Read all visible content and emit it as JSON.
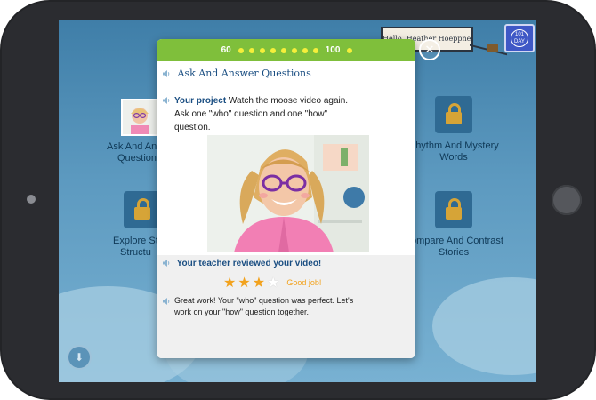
{
  "header": {
    "greeting": "Hello, Heather Hoeppner.",
    "badge_line1": "101",
    "badge_line2": "DAY"
  },
  "tiles": [
    {
      "label": "Ask And Answer Questions",
      "visible_label_start": "Ask And An",
      "visible_label_end": "Question",
      "icon": "student-photo-thumbnail"
    },
    {
      "label": "Rhythm And Mystery Words",
      "icon": "lock-icon"
    },
    {
      "label": "Explore Story Structure",
      "visible_label_start": "Explore St",
      "visible_label_end": "Structu",
      "icon": "lock-icon"
    },
    {
      "label": "Compare And Contrast Stories",
      "icon": "lock-icon"
    }
  ],
  "modal": {
    "progress": {
      "start": "60",
      "end": "100",
      "dot_count": 8
    },
    "title": "Ask And Answer Questions",
    "project_label": "Your project",
    "project_text_1": " Watch the moose video again.",
    "project_text_2": "Ask one \"who\" question and one \"how\"",
    "project_text_3": "question.",
    "reviewed_label": "Your teacher reviewed your video!",
    "rating": {
      "value": 3,
      "max": 4
    },
    "rating_text": "Good job!",
    "feedback_1": "Great work! Your \"who\" question was perfect. Let's",
    "feedback_2": "work on your \"how\" question together."
  },
  "colors": {
    "accent_green": "#7fbf3b",
    "title_blue": "#1a4e82",
    "star_orange": "#f2a21d"
  }
}
